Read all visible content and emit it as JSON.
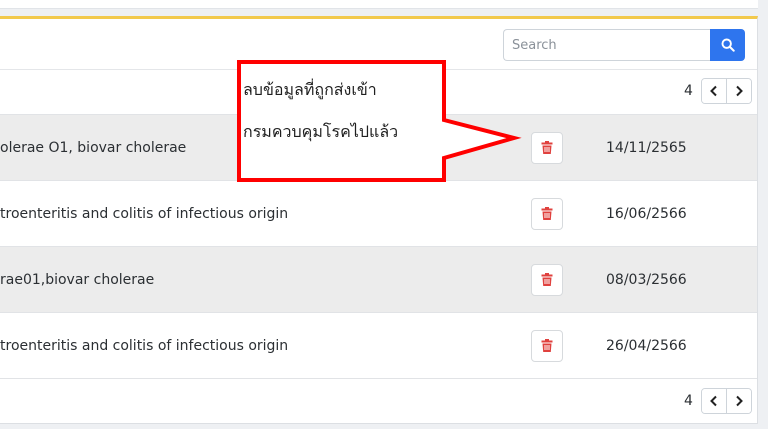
{
  "search": {
    "placeholder": "Search"
  },
  "pagination": {
    "top_page": "4",
    "bottom_page": "4"
  },
  "rows": [
    {
      "disease": "olerae O1, biovar cholerae",
      "date": "14/11/2565"
    },
    {
      "disease": "troenteritis and colitis of infectious origin",
      "date": "16/06/2566"
    },
    {
      "disease": "rae01,biovar cholerae",
      "date": "08/03/2566"
    },
    {
      "disease": "troenteritis and colitis of infectious origin",
      "date": "26/04/2566"
    }
  ],
  "annotation": {
    "line1": "ลบข้อมูลที่ถูกส่งเข้า",
    "line2": "กรมควบคุมโรคไปแล้ว",
    "color": "#ff0000"
  },
  "colors": {
    "accent": "#2e75ee",
    "delete": "#e0413e",
    "card_top_border": "#f2c94c"
  },
  "icons": {
    "search": "search-icon",
    "delete": "trash-icon",
    "prev": "chevron-left-icon",
    "next": "chevron-right-icon"
  }
}
